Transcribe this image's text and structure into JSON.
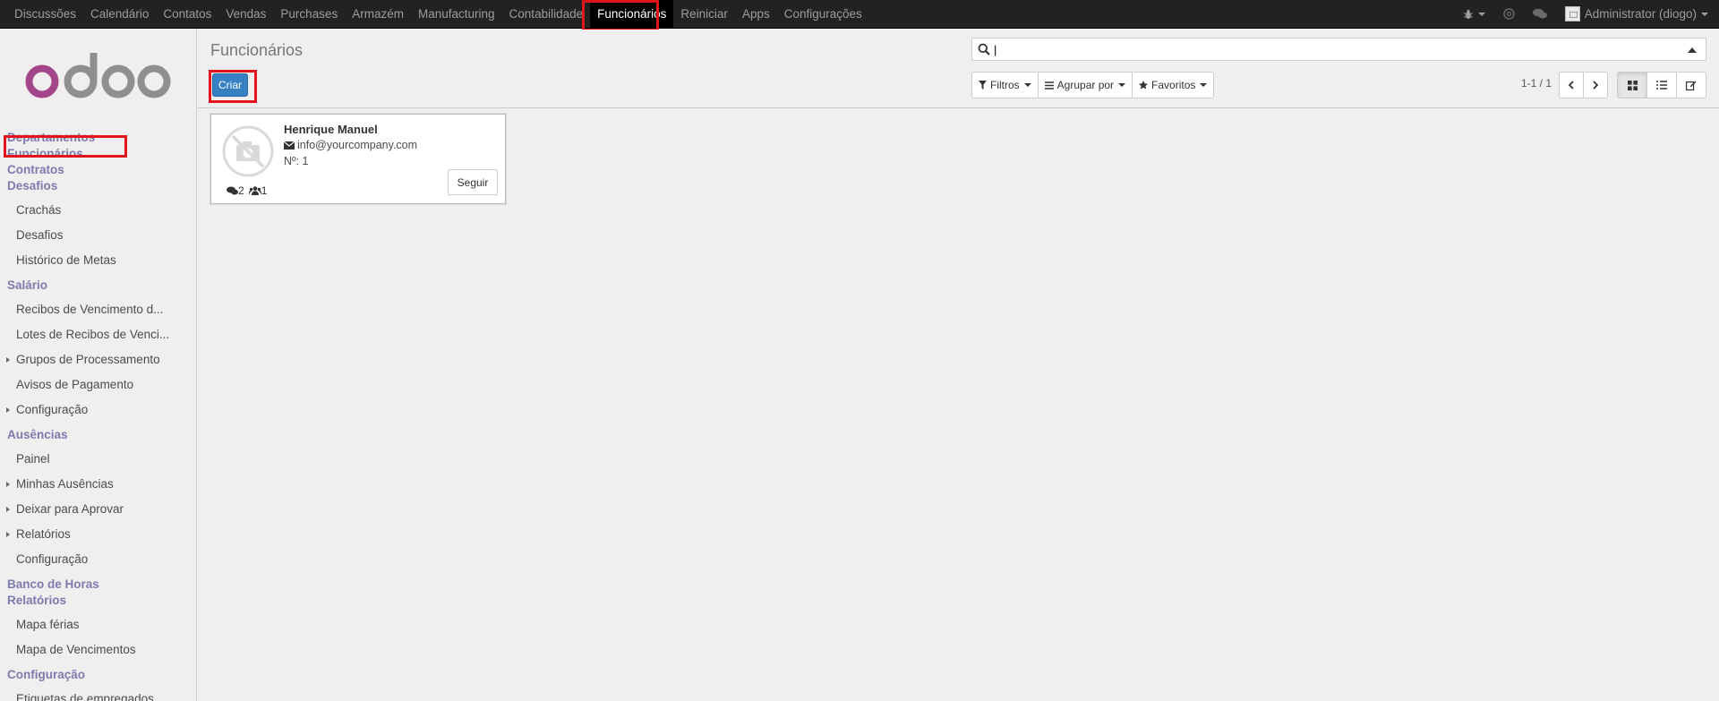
{
  "topbar": {
    "menu": [
      {
        "label": "Discussões",
        "name": "menu-discussoes"
      },
      {
        "label": "Calendário",
        "name": "menu-calendario"
      },
      {
        "label": "Contatos",
        "name": "menu-contatos"
      },
      {
        "label": "Vendas",
        "name": "menu-vendas"
      },
      {
        "label": "Purchases",
        "name": "menu-purchases"
      },
      {
        "label": "Armazém",
        "name": "menu-armazem"
      },
      {
        "label": "Manufacturing",
        "name": "menu-manufacturing"
      },
      {
        "label": "Contabilidade",
        "name": "menu-contabilidade"
      },
      {
        "label": "Funcionários",
        "name": "menu-funcionarios",
        "active": true
      },
      {
        "label": "Reiniciar",
        "name": "menu-reiniciar"
      },
      {
        "label": "Apps",
        "name": "menu-apps"
      },
      {
        "label": "Configurações",
        "name": "menu-configuracoes"
      }
    ],
    "user": "Administrator (diogo)",
    "icons": [
      "bug-icon",
      "at-icon",
      "chat-icon"
    ]
  },
  "sidebar": {
    "logo": "odoo",
    "sections": [
      {
        "type": "sec",
        "label": "Departamentos"
      },
      {
        "type": "sec",
        "label": "Funcionários",
        "highlighted": true
      },
      {
        "type": "sec",
        "label": "Contratos"
      },
      {
        "type": "sec",
        "label": "Desafios"
      },
      {
        "type": "item",
        "label": "Crachás"
      },
      {
        "type": "item",
        "label": "Desafios"
      },
      {
        "type": "item",
        "label": "Histórico de Metas"
      },
      {
        "type": "sec",
        "label": "Salário"
      },
      {
        "type": "item",
        "label": "Recibos de Vencimento d..."
      },
      {
        "type": "item",
        "label": "Lotes de Recibos de Venci..."
      },
      {
        "type": "item",
        "label": "Grupos de Processamento",
        "sub": true
      },
      {
        "type": "item",
        "label": "Avisos de Pagamento"
      },
      {
        "type": "item",
        "label": "Configuração",
        "sub": true
      },
      {
        "type": "sec",
        "label": "Ausências"
      },
      {
        "type": "item",
        "label": "Painel"
      },
      {
        "type": "item",
        "label": "Minhas Ausências",
        "sub": true
      },
      {
        "type": "item",
        "label": "Deixar para Aprovar",
        "sub": true
      },
      {
        "type": "item",
        "label": "Relatórios",
        "sub": true
      },
      {
        "type": "item",
        "label": "Configuração"
      },
      {
        "type": "sec",
        "label": "Banco de Horas"
      },
      {
        "type": "sec",
        "label": "Relatórios"
      },
      {
        "type": "item",
        "label": "Mapa férias"
      },
      {
        "type": "item",
        "label": "Mapa de Vencimentos"
      },
      {
        "type": "sec",
        "label": "Configuração"
      },
      {
        "type": "item",
        "label": "Etiquetas de empregados"
      }
    ]
  },
  "control_panel": {
    "title": "Funcionários",
    "create_label": "Criar",
    "search_value": "|",
    "filters_label": "Filtros",
    "group_by_label": "Agrupar por",
    "favorites_label": "Favoritos",
    "pager": "1-1 / 1"
  },
  "kanban": {
    "records": [
      {
        "name": "Henrique Manuel",
        "email": "info@yourcompany.com",
        "number": "Nº: 1",
        "messages": "2",
        "followers": "1",
        "follow_label": "Seguir"
      }
    ]
  },
  "colors": {
    "topbar": "#222222",
    "accent": "#7c7bad",
    "primary_button": "#3680c4",
    "highlight_box": "#e3141c"
  }
}
